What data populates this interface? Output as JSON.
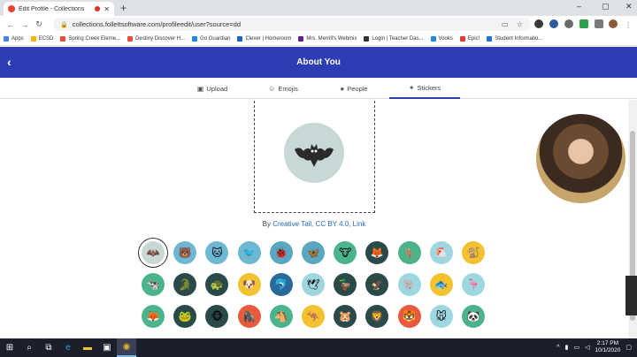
{
  "browser": {
    "tab_title": "Edit Profile - Collections",
    "new_tab": "+",
    "url": "collections.follettsoftware.com/profileedit/user?source=dd",
    "window_controls": [
      "–",
      "▢",
      "✕"
    ],
    "bookmarks": [
      {
        "label": "Apps",
        "color": "#4285f4"
      },
      {
        "label": "ECSD",
        "color": "#f4b400"
      },
      {
        "label": "Spring Creek Eleme...",
        "color": "#e74c3c"
      },
      {
        "label": "Destiny Discover H...",
        "color": "#e74c3c"
      },
      {
        "label": "Go Guardian",
        "color": "#1e88e5"
      },
      {
        "label": "Clever | Homeroom",
        "color": "#1565c0"
      },
      {
        "label": "Mrs. Merrill's Webmix",
        "color": "#6a1b9a"
      },
      {
        "label": "Login | Teacher Das...",
        "color": "#333333"
      },
      {
        "label": "Vooks",
        "color": "#1e88e5"
      },
      {
        "label": "Epic!",
        "color": "#e53935"
      },
      {
        "label": "Student Informatio...",
        "color": "#1976d2"
      }
    ]
  },
  "header": {
    "title": "About You",
    "back_icon": "‹"
  },
  "tabs": [
    {
      "icon": "▣",
      "label": "Upload",
      "active": false
    },
    {
      "icon": "☺",
      "label": "Emojis",
      "active": false
    },
    {
      "icon": "●",
      "label": "People",
      "active": false
    },
    {
      "icon": "✦",
      "label": "Stickers",
      "active": true
    }
  ],
  "attribution": {
    "prefix": "By ",
    "link": "Creative Tail, CC BY 4.0, Link"
  },
  "stickers": [
    [
      {
        "name": "bat",
        "bg": "#c8d8d6",
        "glyph": "🦇"
      },
      {
        "name": "bear",
        "bg": "#6fb8d4",
        "glyph": "🐻"
      },
      {
        "name": "cat",
        "bg": "#6fb8d4",
        "glyph": "🐱"
      },
      {
        "name": "bird",
        "bg": "#6fb8d4",
        "glyph": "🐦"
      },
      {
        "name": "bug",
        "bg": "#5aa7c2",
        "glyph": "🐞"
      },
      {
        "name": "butterfly",
        "bg": "#5aa7c2",
        "glyph": "🦋"
      },
      {
        "name": "cow",
        "bg": "#4bb48a",
        "glyph": "🐮"
      },
      {
        "name": "fox",
        "bg": "#2a4a4a",
        "glyph": "🦊"
      },
      {
        "name": "deer",
        "bg": "#4bb48a",
        "glyph": "🦌"
      },
      {
        "name": "chicken",
        "bg": "#9fd7e0",
        "glyph": "🐔"
      },
      {
        "name": "lemur",
        "bg": "#f2c230",
        "glyph": "🐒"
      }
    ],
    [
      {
        "name": "cow-2",
        "bg": "#4bb48a",
        "glyph": "🐄"
      },
      {
        "name": "crocodile",
        "bg": "#2a4a4a",
        "glyph": "🐊"
      },
      {
        "name": "turtle",
        "bg": "#2a4a4a",
        "glyph": "🐢"
      },
      {
        "name": "dog",
        "bg": "#f2c230",
        "glyph": "🐶"
      },
      {
        "name": "dolphin",
        "bg": "#2a6a9a",
        "glyph": "🐬"
      },
      {
        "name": "dove",
        "bg": "#9fd7e0",
        "glyph": "🕊"
      },
      {
        "name": "duck",
        "bg": "#2a4a4a",
        "glyph": "🦆"
      },
      {
        "name": "eagle",
        "bg": "#2a4a4a",
        "glyph": "🦅"
      },
      {
        "name": "elephant",
        "bg": "#9fd7e0",
        "glyph": "🐘"
      },
      {
        "name": "fish",
        "bg": "#f2c230",
        "glyph": "🐟"
      },
      {
        "name": "flamingo",
        "bg": "#9fd7e0",
        "glyph": "🦩"
      }
    ],
    [
      {
        "name": "fox-2",
        "bg": "#4bb48a",
        "glyph": "🦊"
      },
      {
        "name": "frog",
        "bg": "#2a4a4a",
        "glyph": "🐸"
      },
      {
        "name": "monkey",
        "bg": "#2a4a4a",
        "glyph": "🐵"
      },
      {
        "name": "gorilla",
        "bg": "#e85a3c",
        "glyph": "🦍"
      },
      {
        "name": "horse",
        "bg": "#4bb48a",
        "glyph": "🐴"
      },
      {
        "name": "kangaroo",
        "bg": "#f2c230",
        "glyph": "🦘"
      },
      {
        "name": "hamster",
        "bg": "#2a4a4a",
        "glyph": "🐹"
      },
      {
        "name": "lion",
        "bg": "#2a4a4a",
        "glyph": "🦁"
      },
      {
        "name": "lion-2",
        "bg": "#e85a3c",
        "glyph": "🐯"
      },
      {
        "name": "mouse",
        "bg": "#9fd7e0",
        "glyph": "🐭"
      },
      {
        "name": "panda",
        "bg": "#4bb48a",
        "glyph": "🐼"
      }
    ]
  ],
  "taskbar": {
    "time": "2:17 PM",
    "date": "10/1/2020"
  }
}
